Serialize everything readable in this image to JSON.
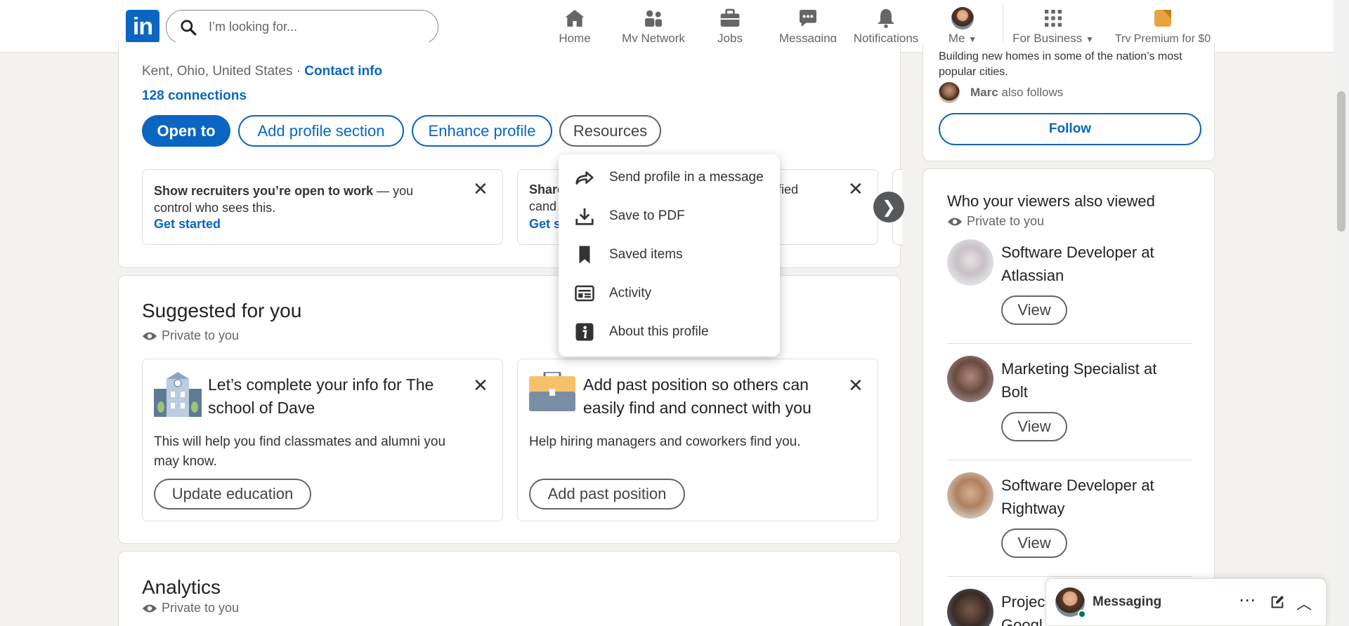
{
  "nav": {
    "logo_text": "in",
    "search_placeholder": "I’m looking for...",
    "items": [
      {
        "label": "Home",
        "icon": "home-icon"
      },
      {
        "label": "My Network",
        "icon": "network-icon"
      },
      {
        "label": "Jobs",
        "icon": "briefcase-icon"
      },
      {
        "label": "Messaging",
        "icon": "messaging-icon"
      },
      {
        "label": "Notifications",
        "icon": "bell-icon"
      },
      {
        "label": "Me",
        "icon": "avatar"
      },
      {
        "label": "For Business",
        "icon": "grid-icon"
      },
      {
        "label": "Try Premium for $0",
        "icon": "premium-icon"
      }
    ]
  },
  "profile": {
    "location": "Kent, Ohio, United States",
    "separator": "·",
    "contact_info": "Contact info",
    "connections": "128 connections",
    "buttons": {
      "open_to": "Open to",
      "add_section": "Add profile section",
      "enhance": "Enhance profile",
      "resources": "Resources"
    },
    "open_to_work": {
      "bold": "Show recruiters you’re open to work",
      "rest": " — you control who sees this.",
      "action": "Get started"
    },
    "second_card": {
      "line1_start": "Share",
      "line1_end": "fied",
      "line2": "cand",
      "action": "Get s"
    }
  },
  "resources_menu": {
    "items": [
      {
        "label": "Send profile in a message",
        "icon": "share-arrow-icon"
      },
      {
        "label": "Save to PDF",
        "icon": "download-icon"
      },
      {
        "label": "Saved items",
        "icon": "bookmark-icon"
      },
      {
        "label": "Activity",
        "icon": "activity-icon"
      },
      {
        "label": "About this profile",
        "icon": "info-icon"
      }
    ]
  },
  "suggested": {
    "title": "Suggested for you",
    "privacy": "Private to you",
    "cards": [
      {
        "title": "Let’s complete your info for The school of Dave",
        "body": "This will help you find classmates and alumni you may know.",
        "button": "Update education"
      },
      {
        "title": "Add past position so others can easily find and connect with you",
        "body": "Help hiring managers and coworkers find you.",
        "button": "Add past position"
      }
    ]
  },
  "analytics": {
    "title": "Analytics",
    "privacy": "Private to you"
  },
  "sidebar": {
    "follow_snippet": "Building new homes in some of the nation’s most popular cities.",
    "follower_name": "Marc",
    "follower_suffix": " also follows",
    "follow_button": "Follow",
    "viewers_title": "Who your viewers also viewed",
    "viewers_privacy": "Private to you",
    "people": [
      {
        "title": "Software Developer at Atlassian",
        "button": "View"
      },
      {
        "title": "Marketing Specialist at Bolt",
        "button": "View"
      },
      {
        "title": "Software Developer at Rightway",
        "button": "View"
      },
      {
        "title": "Projec",
        "subtitle": "Googl"
      }
    ]
  },
  "messaging_bar": {
    "label": "Messaging"
  },
  "colors": {
    "brand": "#0a66c2",
    "background": "#f4f2ee",
    "premium": "#e7a33e"
  }
}
